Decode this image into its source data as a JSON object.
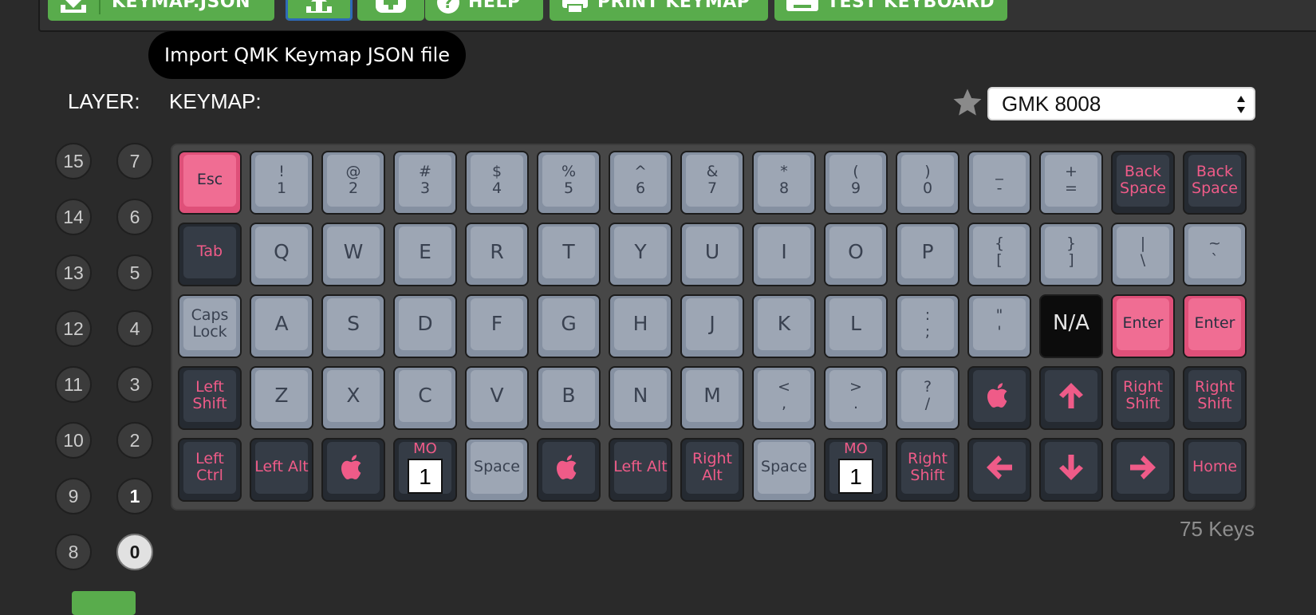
{
  "toolbar": {
    "buttons": [
      {
        "id": "download",
        "label": "KEYMAP.JSON",
        "icon": "download-icon"
      },
      {
        "id": "import",
        "label": "",
        "icon": "upload-icon",
        "active": true
      },
      {
        "id": "compile",
        "label": "",
        "icon": "plus-icon"
      },
      {
        "id": "help",
        "label": "HELP",
        "icon": "help-icon"
      },
      {
        "id": "print",
        "label": "PRINT KEYMAP",
        "icon": "printer-icon"
      },
      {
        "id": "test",
        "label": "TEST KEYBOARD",
        "icon": "keyboard-icon"
      }
    ],
    "tooltip": "Import QMK Keymap JSON file"
  },
  "labels": {
    "layer": "LAYER:",
    "keymap": "KEYMAP:",
    "key_count": "75 Keys"
  },
  "colorway": {
    "selected": "GMK 8008",
    "icon": "star-icon"
  },
  "layers": {
    "left": [
      "15",
      "14",
      "13",
      "12",
      "11",
      "10",
      "9",
      "8"
    ],
    "right": [
      "7",
      "6",
      "5",
      "4",
      "3",
      "2",
      "1",
      "0"
    ],
    "selected": "0",
    "with_data": [
      "1"
    ]
  },
  "colors": {
    "accent_green": "#59ac4c",
    "key_pink": "#f06d93",
    "key_grey": "#9da6b4",
    "key_dark": "#353c46",
    "legend_pink": "#ef5b88"
  },
  "keyboard": {
    "rows": [
      [
        {
          "label": "Esc",
          "style": "pink",
          "size": "word"
        },
        {
          "label": "!\n1",
          "style": "grey",
          "size": "sym"
        },
        {
          "label": "@\n2",
          "style": "grey",
          "size": "sym"
        },
        {
          "label": "#\n3",
          "style": "grey",
          "size": "sym"
        },
        {
          "label": "$\n4",
          "style": "grey",
          "size": "sym"
        },
        {
          "label": "%\n5",
          "style": "grey",
          "size": "sym"
        },
        {
          "label": "^\n6",
          "style": "grey",
          "size": "sym"
        },
        {
          "label": "&\n7",
          "style": "grey",
          "size": "sym"
        },
        {
          "label": "*\n8",
          "style": "grey",
          "size": "sym"
        },
        {
          "label": "(\n9",
          "style": "grey",
          "size": "sym"
        },
        {
          "label": ")\n0",
          "style": "grey",
          "size": "sym"
        },
        {
          "label": "_\n-",
          "style": "grey",
          "size": "sym"
        },
        {
          "label": "+\n=",
          "style": "grey",
          "size": "sym"
        },
        {
          "label": "Back\nSpace",
          "style": "dark",
          "size": "word"
        },
        {
          "label": "Back\nSpace",
          "style": "dark",
          "size": "word"
        }
      ],
      [
        {
          "label": "Tab",
          "style": "dark",
          "size": "word"
        },
        {
          "label": "Q",
          "style": "grey",
          "size": "big"
        },
        {
          "label": "W",
          "style": "grey",
          "size": "big"
        },
        {
          "label": "E",
          "style": "grey",
          "size": "big"
        },
        {
          "label": "R",
          "style": "grey",
          "size": "big"
        },
        {
          "label": "T",
          "style": "grey",
          "size": "big"
        },
        {
          "label": "Y",
          "style": "grey",
          "size": "big"
        },
        {
          "label": "U",
          "style": "grey",
          "size": "big"
        },
        {
          "label": "I",
          "style": "grey",
          "size": "big"
        },
        {
          "label": "O",
          "style": "grey",
          "size": "big"
        },
        {
          "label": "P",
          "style": "grey",
          "size": "big"
        },
        {
          "label": "{\n[",
          "style": "grey",
          "size": "sym"
        },
        {
          "label": "}\n]",
          "style": "grey",
          "size": "sym"
        },
        {
          "label": "|\n\\",
          "style": "grey",
          "size": "sym"
        },
        {
          "label": "~\n`",
          "style": "grey",
          "size": "sym"
        }
      ],
      [
        {
          "label": "Caps\nLock",
          "style": "grey",
          "size": "word"
        },
        {
          "label": "A",
          "style": "grey",
          "size": "big"
        },
        {
          "label": "S",
          "style": "grey",
          "size": "big"
        },
        {
          "label": "D",
          "style": "grey",
          "size": "big"
        },
        {
          "label": "F",
          "style": "grey",
          "size": "big"
        },
        {
          "label": "G",
          "style": "grey",
          "size": "big"
        },
        {
          "label": "H",
          "style": "grey",
          "size": "big"
        },
        {
          "label": "J",
          "style": "grey",
          "size": "big"
        },
        {
          "label": "K",
          "style": "grey",
          "size": "big"
        },
        {
          "label": "L",
          "style": "grey",
          "size": "big"
        },
        {
          "label": ":\n;",
          "style": "grey",
          "size": "sym"
        },
        {
          "label": "\"\n'",
          "style": "grey",
          "size": "sym"
        },
        {
          "label": "N/A",
          "style": "black",
          "size": "na"
        },
        {
          "label": "Enter",
          "style": "pink",
          "size": "word"
        },
        {
          "label": "Enter",
          "style": "pink",
          "size": "word"
        }
      ],
      [
        {
          "label": "Left\nShift",
          "style": "dark",
          "size": "word"
        },
        {
          "label": "Z",
          "style": "grey",
          "size": "big"
        },
        {
          "label": "X",
          "style": "grey",
          "size": "big"
        },
        {
          "label": "C",
          "style": "grey",
          "size": "big"
        },
        {
          "label": "V",
          "style": "grey",
          "size": "big"
        },
        {
          "label": "B",
          "style": "grey",
          "size": "big"
        },
        {
          "label": "N",
          "style": "grey",
          "size": "big"
        },
        {
          "label": "M",
          "style": "grey",
          "size": "big"
        },
        {
          "label": "<\n,",
          "style": "grey",
          "size": "sym"
        },
        {
          "label": ">\n.",
          "style": "grey",
          "size": "sym"
        },
        {
          "label": "?\n/",
          "style": "grey",
          "size": "sym"
        },
        {
          "icon": "apple-icon",
          "style": "dark"
        },
        {
          "icon": "arrow-up-icon",
          "style": "dark"
        },
        {
          "label": "Right\nShift",
          "style": "dark",
          "size": "word"
        },
        {
          "label": "Right\nShift",
          "style": "dark",
          "size": "word"
        }
      ],
      [
        {
          "label": "Left\nCtrl",
          "style": "dark",
          "size": "word"
        },
        {
          "label": "Left Alt",
          "style": "dark",
          "size": "word"
        },
        {
          "icon": "apple-icon",
          "style": "dark"
        },
        {
          "label": "MO",
          "mo": "1",
          "style": "dark"
        },
        {
          "label": "Space",
          "style": "grey",
          "size": "word"
        },
        {
          "icon": "apple-icon",
          "style": "dark"
        },
        {
          "label": "Left Alt",
          "style": "dark",
          "size": "word"
        },
        {
          "label": "Right\nAlt",
          "style": "dark",
          "size": "word"
        },
        {
          "label": "Space",
          "style": "grey",
          "size": "word"
        },
        {
          "label": "MO",
          "mo": "1",
          "style": "dark"
        },
        {
          "label": "Right\nShift",
          "style": "dark",
          "size": "word"
        },
        {
          "icon": "arrow-left-icon",
          "style": "dark"
        },
        {
          "icon": "arrow-down-icon",
          "style": "dark"
        },
        {
          "icon": "arrow-right-icon",
          "style": "dark"
        },
        {
          "label": "Home",
          "style": "dark",
          "size": "word"
        }
      ]
    ]
  }
}
